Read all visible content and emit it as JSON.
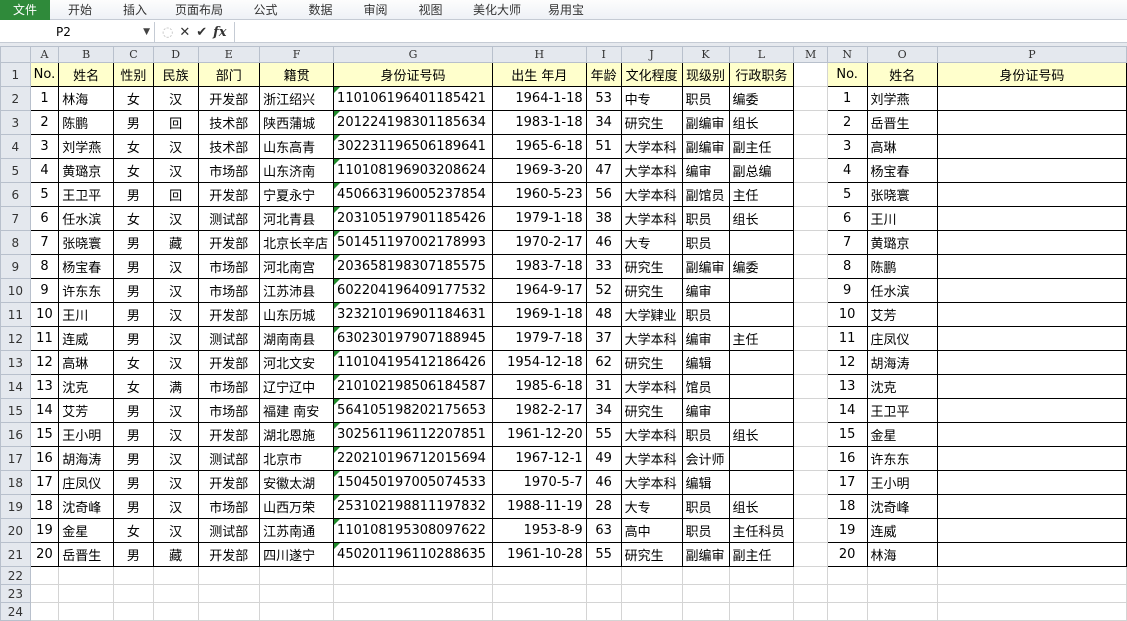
{
  "ribbon": {
    "tabs": [
      "文件",
      "开始",
      "插入",
      "页面布局",
      "公式",
      "数据",
      "审阅",
      "视图",
      "美化大师",
      "易用宝"
    ]
  },
  "formula_bar": {
    "name_box": "P2",
    "value": ""
  },
  "columns": [
    "A",
    "B",
    "C",
    "D",
    "E",
    "F",
    "G",
    "H",
    "I",
    "J",
    "K",
    "L",
    "M",
    "N",
    "O",
    "P"
  ],
  "row_numbers": [
    1,
    2,
    3,
    4,
    5,
    6,
    7,
    8,
    9,
    10,
    11,
    12,
    13,
    14,
    15,
    16,
    17,
    18,
    19,
    20,
    21,
    22,
    23,
    24
  ],
  "main_table": {
    "headers": [
      "No.",
      "姓名",
      "性别",
      "民族",
      "部门",
      "籍贯",
      "身份证号码",
      "出生 年月",
      "年龄",
      "文化程度",
      "现级别",
      "行政职务"
    ],
    "rows": [
      [
        "1",
        "林海",
        "女",
        "汉",
        "开发部",
        "浙江绍兴",
        "110106196401185421",
        "1964-1-18",
        "53",
        "中专",
        "职员",
        "编委"
      ],
      [
        "2",
        "陈鹏",
        "男",
        "回",
        "技术部",
        "陕西蒲城",
        "201224198301185634",
        "1983-1-18",
        "34",
        "研究生",
        "副编审",
        "组长"
      ],
      [
        "3",
        "刘学燕",
        "女",
        "汉",
        "技术部",
        "山东高青",
        "302231196506189641",
        "1965-6-18",
        "51",
        "大学本科",
        "副编审",
        "副主任"
      ],
      [
        "4",
        "黄璐京",
        "女",
        "汉",
        "市场部",
        "山东济南",
        "110108196903208624",
        "1969-3-20",
        "47",
        "大学本科",
        "编审",
        "副总编"
      ],
      [
        "5",
        "王卫平",
        "男",
        "回",
        "开发部",
        "宁夏永宁",
        "450663196005237854",
        "1960-5-23",
        "56",
        "大学本科",
        "副馆员",
        "主任"
      ],
      [
        "6",
        "任水滨",
        "女",
        "汉",
        "测试部",
        "河北青县",
        "203105197901185426",
        "1979-1-18",
        "38",
        "大学本科",
        "职员",
        "组长"
      ],
      [
        "7",
        "张晓寰",
        "男",
        "藏",
        "开发部",
        "北京长辛店",
        "501451197002178993",
        "1970-2-17",
        "46",
        "大专",
        "职员",
        ""
      ],
      [
        "8",
        "杨宝春",
        "男",
        "汉",
        "市场部",
        "河北南宫",
        "203658198307185575",
        "1983-7-18",
        "33",
        "研究生",
        "副编审",
        "编委"
      ],
      [
        "9",
        "许东东",
        "男",
        "汉",
        "市场部",
        "江苏沛县",
        "602204196409177532",
        "1964-9-17",
        "52",
        "研究生",
        "编审",
        ""
      ],
      [
        "10",
        "王川",
        "男",
        "汉",
        "开发部",
        "山东历城",
        "323210196901184631",
        "1969-1-18",
        "48",
        "大学肄业",
        "职员",
        ""
      ],
      [
        "11",
        "连威",
        "男",
        "汉",
        "测试部",
        "湖南南县",
        "630230197907188945",
        "1979-7-18",
        "37",
        "大学本科",
        "编审",
        "主任"
      ],
      [
        "12",
        "高琳",
        "女",
        "汉",
        "开发部",
        "河北文安",
        "110104195412186426",
        "1954-12-18",
        "62",
        "研究生",
        "编辑",
        ""
      ],
      [
        "13",
        "沈克",
        "女",
        "满",
        "市场部",
        "辽宁辽中",
        "210102198506184587",
        "1985-6-18",
        "31",
        "大学本科",
        "馆员",
        ""
      ],
      [
        "14",
        "艾芳",
        "男",
        "汉",
        "市场部",
        "福建  南安",
        "564105198202175653",
        "1982-2-17",
        "34",
        "研究生",
        "编审",
        ""
      ],
      [
        "15",
        "王小明",
        "男",
        "汉",
        "开发部",
        "湖北恩施",
        "302561196112207851",
        "1961-12-20",
        "55",
        "大学本科",
        "职员",
        "组长"
      ],
      [
        "16",
        "胡海涛",
        "男",
        "汉",
        "测试部",
        "北京市",
        "220210196712015694",
        "1967-12-1",
        "49",
        "大学本科",
        "会计师",
        ""
      ],
      [
        "17",
        "庄凤仪",
        "男",
        "汉",
        "开发部",
        "安徽太湖",
        "150450197005074533",
        "1970-5-7",
        "46",
        "大学本科",
        "编辑",
        ""
      ],
      [
        "18",
        "沈奇峰",
        "男",
        "汉",
        "市场部",
        "山西万荣",
        "253102198811197832",
        "1988-11-19",
        "28",
        "大专",
        "职员",
        "组长"
      ],
      [
        "19",
        "金星",
        "女",
        "汉",
        "测试部",
        "江苏南通",
        "110108195308097622",
        "1953-8-9",
        "63",
        "高中",
        "职员",
        "主任科员"
      ],
      [
        "20",
        "岳晋生",
        "男",
        "藏",
        "开发部",
        "四川遂宁",
        "450201196110288635",
        "1961-10-28",
        "55",
        "研究生",
        "副编审",
        "副主任"
      ]
    ]
  },
  "lookup_table": {
    "headers": [
      "No.",
      "姓名",
      "身份证号码"
    ],
    "rows": [
      [
        "1",
        "刘学燕",
        ""
      ],
      [
        "2",
        "岳晋生",
        ""
      ],
      [
        "3",
        "高琳",
        ""
      ],
      [
        "4",
        "杨宝春",
        ""
      ],
      [
        "5",
        "张晓寰",
        ""
      ],
      [
        "6",
        "王川",
        ""
      ],
      [
        "7",
        "黄璐京",
        ""
      ],
      [
        "8",
        "陈鹏",
        ""
      ],
      [
        "9",
        "任水滨",
        ""
      ],
      [
        "10",
        "艾芳",
        ""
      ],
      [
        "11",
        "庄凤仪",
        ""
      ],
      [
        "12",
        "胡海涛",
        ""
      ],
      [
        "13",
        "沈克",
        ""
      ],
      [
        "14",
        "王卫平",
        ""
      ],
      [
        "15",
        "金星",
        ""
      ],
      [
        "16",
        "许东东",
        ""
      ],
      [
        "17",
        "王小明",
        ""
      ],
      [
        "18",
        "沈奇峰",
        ""
      ],
      [
        "19",
        "连威",
        ""
      ],
      [
        "20",
        "林海",
        ""
      ]
    ]
  },
  "colors": {
    "header_fill": "#ffffcc",
    "file_tab": "#2f8a3a",
    "text_marker": "#1f8a2a"
  }
}
